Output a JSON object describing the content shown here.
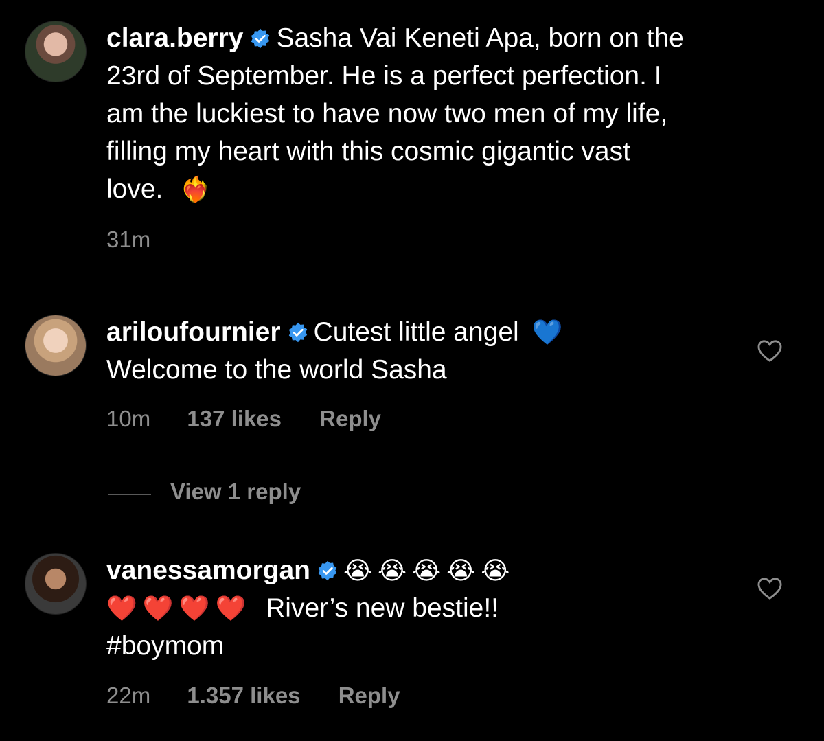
{
  "comments": [
    {
      "username": "clara.berry",
      "verified": true,
      "text_lines": [
        "Sasha Vai Keneti Apa, born on the",
        "23rd of September. He is a perfect perfection. I",
        "am the luckiest to have now two men of my life,",
        "filling my heart with this cosmic gigantic vast",
        "love."
      ],
      "emoji": "❤️‍🔥",
      "time": "31m"
    },
    {
      "username": "ariloufournier",
      "verified": true,
      "text_lines": [
        "Cutest little angel",
        "Welcome to the world Sasha"
      ],
      "emoji": "💙",
      "time": "10m",
      "likes": "137 likes",
      "reply_label": "Reply",
      "view_replies": "View 1 reply"
    },
    {
      "username": "vanessamorgan",
      "verified": true,
      "emoji_line1": "😭😭😭😭😭",
      "emoji_line2": "❤️❤️❤️❤️",
      "text_line2": "River’s new bestie!!",
      "text_line3": "#boymom",
      "time": "22m",
      "likes": "1.357 likes",
      "reply_label": "Reply"
    }
  ],
  "colors": {
    "verified": "#3897f0",
    "meta": "#8e8e8e",
    "background": "#000000"
  }
}
